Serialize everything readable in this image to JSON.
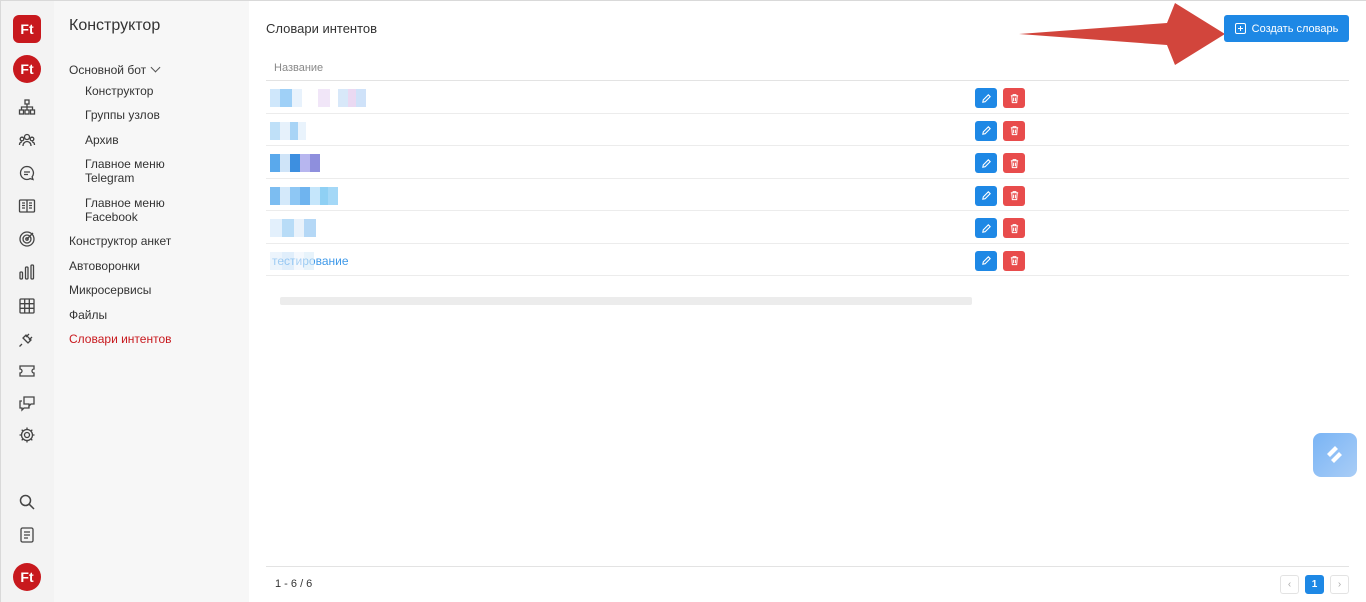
{
  "rail": {
    "top_logo": "Ft",
    "bot_logo": "Ft",
    "user_logo": "Ft",
    "icons": [
      "nodes-icon",
      "people-icon",
      "chat-icon",
      "book-icon",
      "target-icon",
      "bar-chart-icon",
      "grid-icon",
      "plug-icon",
      "ticket-icon",
      "messages-icon",
      "gear-icon",
      "search-icon",
      "doc-icon"
    ]
  },
  "nav": {
    "title": "Конструктор",
    "bot_label": "Основной бот",
    "sub_items": [
      "Конструктор",
      "Группы узлов",
      "Архив",
      "Главное меню Telegram",
      "Главное меню Facebook"
    ],
    "items": [
      "Конструктор анкет",
      "Автоворонки",
      "Микросервисы",
      "Файлы",
      "Словари интентов"
    ],
    "active_index": 4
  },
  "main": {
    "title": "Словари интентов",
    "create_label": "Создать словарь",
    "column_name": "Название",
    "visible_row_name": "тестирование",
    "row_count": 6,
    "range_text": "1 - 6 / 6",
    "prev_label": "‹",
    "next_label": "›",
    "current_page": "1"
  },
  "colors": {
    "brand": "#c8191e",
    "primary": "#1e88e5",
    "danger": "#e84c4c",
    "arrow": "#d2453c"
  }
}
